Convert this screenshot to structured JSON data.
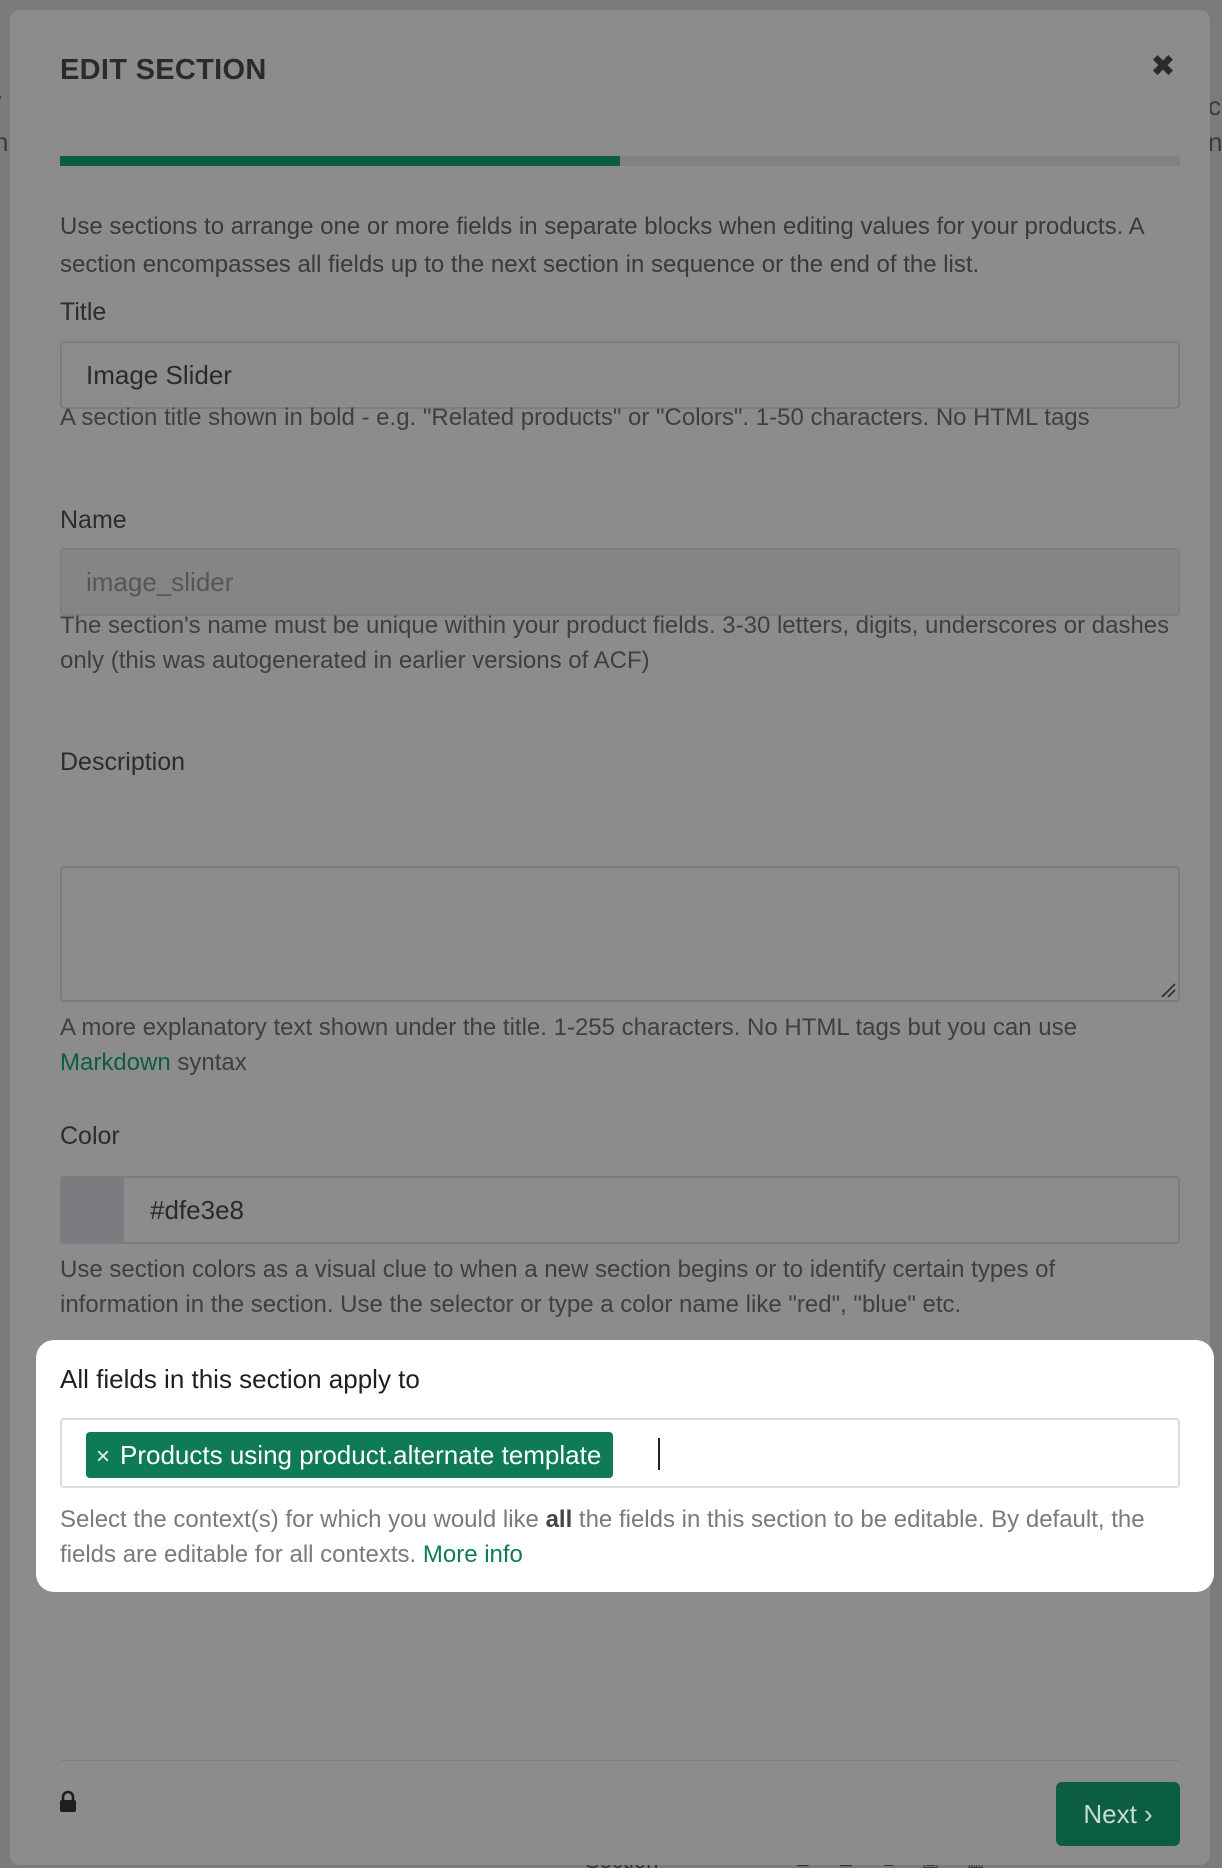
{
  "modal": {
    "title": "EDIT SECTION",
    "close_icon": "close-icon",
    "progress_percent": 50,
    "intro": "Use sections to arrange one or more fields in separate blocks when editing values for your products. A section encompasses all fields up to the next section in sequence or the end of the list."
  },
  "title_field": {
    "label": "Title",
    "value": "Image Slider",
    "help": "A section title shown in bold - e.g. \"Related products\" or \"Colors\". 1-50 characters. No HTML tags"
  },
  "name_field": {
    "label": "Name",
    "value": "image_slider",
    "help": "The section's name must be unique within your product fields. 3-30 letters, digits, underscores or dashes only (this was autogenerated in earlier versions of ACF)"
  },
  "description_field": {
    "label": "Description",
    "value": "",
    "help_prefix": "A more explanatory text shown under the title. 1-255 characters. No HTML tags but you can use ",
    "help_link": "Markdown",
    "help_suffix": " syntax"
  },
  "color_field": {
    "label": "Color",
    "value": "#dfe3e8",
    "help": "Use section colors as a visual clue to when a new section begins or to identify certain types of information in the section. Use the selector or type a color name like \"red\", \"blue\" etc."
  },
  "context_field": {
    "label": "All fields in this section apply to",
    "tag_remove": "×",
    "tag_label": "Products using product.alternate template",
    "help_prefix": "Select the context(s) for which you would like ",
    "help_bold": "all",
    "help_suffix": " the fields in this section to be editable. By default, the fields are editable for all contexts. ",
    "help_link": "More info"
  },
  "footer": {
    "lock_icon": "lock-icon",
    "next_label": "Next ›"
  },
  "background": {
    "left_chars": [
      "/",
      "n",
      "i"
    ],
    "right_chars": [
      "c",
      "ne"
    ],
    "bottom_text": "Section"
  },
  "colors": {
    "accent": "#0f7a56",
    "button": "#0b5e42",
    "progress": "#0c5d43",
    "swatch": "#dfe3e8"
  }
}
